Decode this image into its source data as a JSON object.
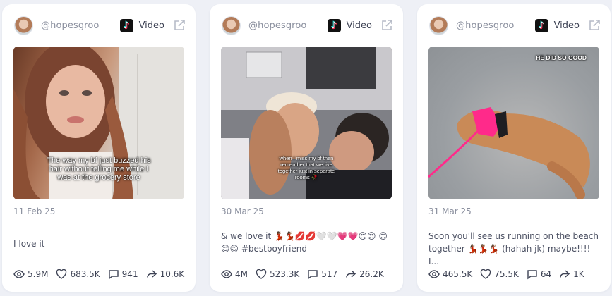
{
  "colors": {
    "background": "#eef0f6",
    "card": "#ffffff",
    "text": "#3d4254",
    "muted": "#8a8f9e"
  },
  "posts": [
    {
      "handle": "@hopesgroo",
      "platform_label": "Video",
      "platform_icon": "tiktok-icon",
      "overlay_text": "The way my bf just buzzed his hair without telling me while I was at the grocery store",
      "date": "11 Feb 25",
      "caption": "I love it",
      "views": "5.9M",
      "likes": "683.5K",
      "comments": "941",
      "shares": "10.6K"
    },
    {
      "handle": "@hopesgroo",
      "platform_label": "Video",
      "platform_icon": "tiktok-icon",
      "overlay_text": "when I miss my bf then remember that we live together just in separate rooms 🥀",
      "date": "30 Mar 25",
      "caption": "& we love it 💃🏾💃🏾💋💋🤍🤍💗💗😍😍 😊😊😊 #bestboyfriend",
      "views": "4M",
      "likes": "523.3K",
      "comments": "517",
      "shares": "26.2K"
    },
    {
      "handle": "@hopesgroo",
      "platform_label": "Video",
      "platform_icon": "tiktok-icon",
      "overlay_text": "HE DID SO GOOD",
      "date": "31 Mar 25",
      "caption": "Soon you'll see us running on the beach together 💃🏾💃🏾💃🏾 (hahah jk) maybe!!!! I...",
      "views": "465.5K",
      "likes": "75.5K",
      "comments": "64",
      "shares": "1K"
    }
  ]
}
